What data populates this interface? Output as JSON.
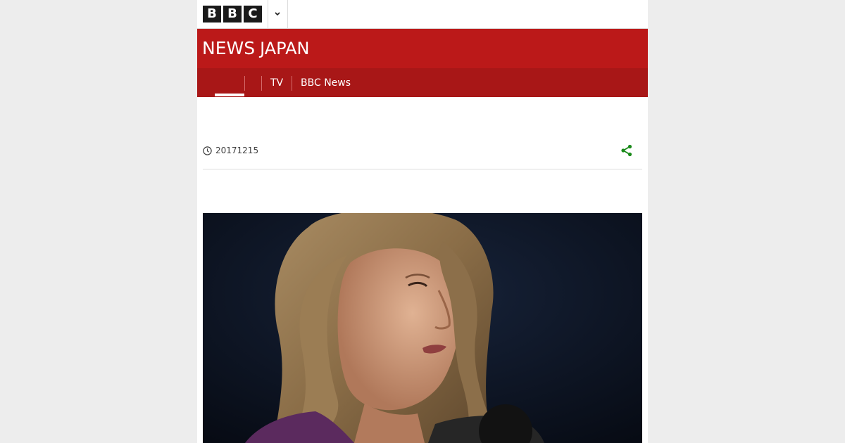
{
  "brand": {
    "logo_letters": [
      "B",
      "B",
      "C"
    ],
    "section_primary": "NEWS",
    "section_secondary": "JAPAN"
  },
  "nav": {
    "items": [
      {
        "label": "",
        "active": true
      },
      {
        "label": ""
      },
      {
        "label": "TV"
      },
      {
        "label": "BBC News"
      }
    ]
  },
  "article": {
    "date": "20171215"
  },
  "icons": {
    "more": "chevron-down-icon",
    "clock": "clock-icon",
    "share": "share-icon"
  },
  "colors": {
    "brand_red": "#bb1919",
    "nav_red": "#a81717",
    "share_green": "#1a8a1a",
    "page_bg": "#ededed"
  }
}
